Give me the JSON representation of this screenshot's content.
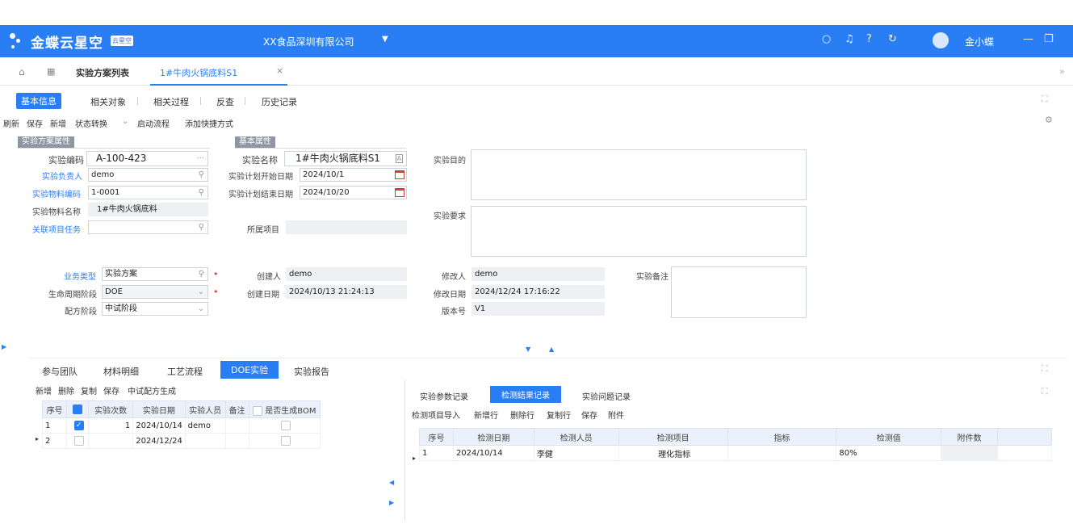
{
  "app": {
    "brand": "金蝶云星空",
    "brand_tag": "云星空",
    "company": "XX食品深圳有限公司",
    "user": "金小蝶",
    "accent": "#2a7ef4"
  },
  "tabs": {
    "list": "实验方案列表",
    "active": "1#牛肉火锅底料S1",
    "close": "×"
  },
  "subtabs": [
    "基本信息",
    "相关对象",
    "相关过程",
    "反查",
    "历史记录"
  ],
  "toolbar": [
    "刷新",
    "保存",
    "新增",
    "状态转换",
    "启动流程",
    "添加快捷方式"
  ],
  "sections": {
    "scheme": "实验方案属性",
    "basic": "基本属性"
  },
  "form": {
    "code_label": "实验编码",
    "code_value": "A-100-423",
    "code_suffix": "···",
    "owner_label": "实验负责人",
    "owner_value": "demo",
    "material_code_label": "实验物料编码",
    "material_code_value": "1-0001",
    "material_name_label": "实验物料名称",
    "material_name_value": "1#牛肉火锅底料",
    "task_label": "关联项目任务",
    "task_value": "",
    "name_label": "实验名称",
    "name_value": "1#牛肉火锅底料S1",
    "name_suffix": "A",
    "start_label": "实验计划开始日期",
    "start_value": "2024/10/1",
    "end_label": "实验计划结束日期",
    "end_value": "2024/10/20",
    "project_label": "所属项目",
    "project_value": "",
    "purpose_label": "实验目的",
    "requirement_label": "实验要求",
    "biz_type_label": "业务类型",
    "biz_type_value": "实验方案",
    "lifecycle_label": "生命周期阶段",
    "lifecycle_value": "DOE",
    "formula_label": "配方阶段",
    "formula_value": "中试阶段",
    "creator_label": "创建人",
    "creator_value": "demo",
    "created_label": "创建日期",
    "created_value": "2024/10/13 21:24:13",
    "modifier_label": "修改人",
    "modifier_value": "demo",
    "modified_label": "修改日期",
    "modified_value": "2024/12/24 17:16:22",
    "version_label": "版本号",
    "version_value": "V1",
    "remark_label": "实验备注"
  },
  "lower_tabs": [
    "参与团队",
    "材料明细",
    "工艺流程",
    "DOE实验",
    "实验报告"
  ],
  "left_toolbar": [
    "新增",
    "删除",
    "复制",
    "保存",
    "中试配方生成"
  ],
  "left_table": {
    "headers": [
      "序号",
      "",
      "实验次数",
      "实验日期",
      "实验人员",
      "备注",
      "是否生成BOM"
    ],
    "rows": [
      {
        "seq": "1",
        "count": "1",
        "date": "2024/10/14",
        "person": "demo",
        "checked": true
      },
      {
        "seq": "2",
        "count": "",
        "date": "2024/12/24",
        "person": "",
        "checked": false
      }
    ]
  },
  "right_tabs": [
    "实验参数记录",
    "检测结果记录",
    "实验问题记录"
  ],
  "right_toolbar": [
    "检测项目导入",
    "新增行",
    "删除行",
    "复制行",
    "保存",
    "附件"
  ],
  "right_table": {
    "headers": [
      "序号",
      "检测日期",
      "检测人员",
      "检测项目",
      "指标",
      "检测值",
      "附件数"
    ],
    "rows": [
      {
        "seq": "1",
        "date": "2024/10/14",
        "person": "李健",
        "item": "理化指标",
        "spec": "",
        "value": "80%",
        "attach": ""
      }
    ]
  }
}
